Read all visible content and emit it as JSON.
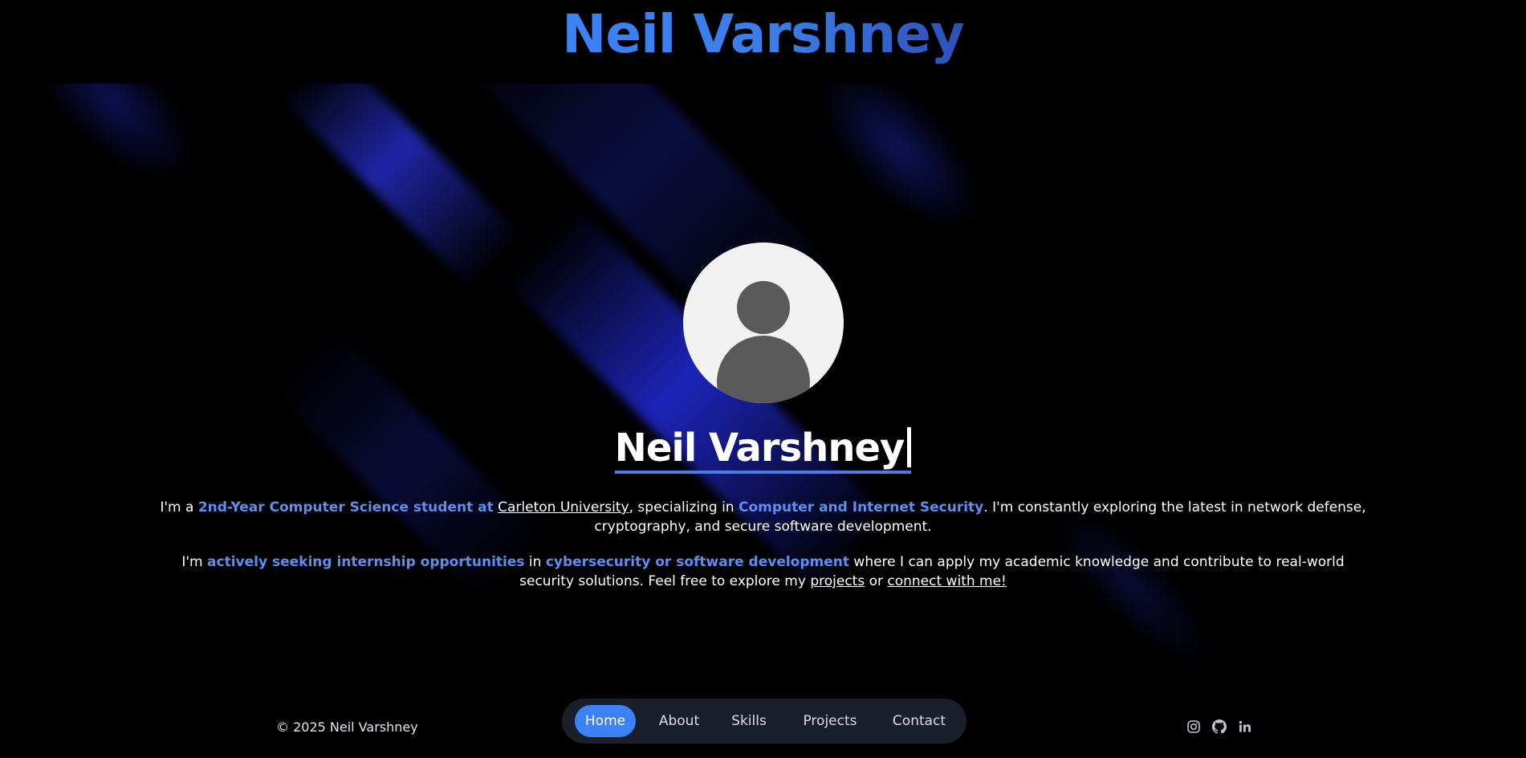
{
  "site": {
    "title": "Neil Varshney"
  },
  "hero": {
    "name": "Neil Varshney",
    "paragraph1": {
      "t1": "I'm a ",
      "h1": "2nd-Year Computer Science student at",
      "t2": " ",
      "link1": "Carleton University",
      "t3": ", specializing in ",
      "h2": "Computer and Internet Security",
      "t4": ". I'm constantly exploring the latest in network defense, cryptography, and secure software development."
    },
    "paragraph2": {
      "t1": "I'm ",
      "h1": "actively seeking internship opportunities",
      "t2": " in ",
      "h2": "cybersecurity or software development",
      "t3": " where I can apply my academic knowledge and contribute to real-world security solutions. Feel free to explore my ",
      "link1": "projects",
      "t4": " or ",
      "link2": "connect with me!"
    }
  },
  "footer": {
    "copyright": "© 2025 Neil Varshney",
    "nav": [
      {
        "label": "Home",
        "active": true
      },
      {
        "label": "About",
        "active": false
      },
      {
        "label": "Skills",
        "active": false
      },
      {
        "label": "Projects",
        "active": false
      },
      {
        "label": "Contact",
        "active": false
      }
    ],
    "socials": [
      "instagram-icon",
      "github-icon",
      "linkedin-icon"
    ]
  },
  "colors": {
    "accent": "#3b82f6",
    "highlight": "#5b8ff0",
    "background": "#000000",
    "nav_bg": "#1a1f2c"
  }
}
